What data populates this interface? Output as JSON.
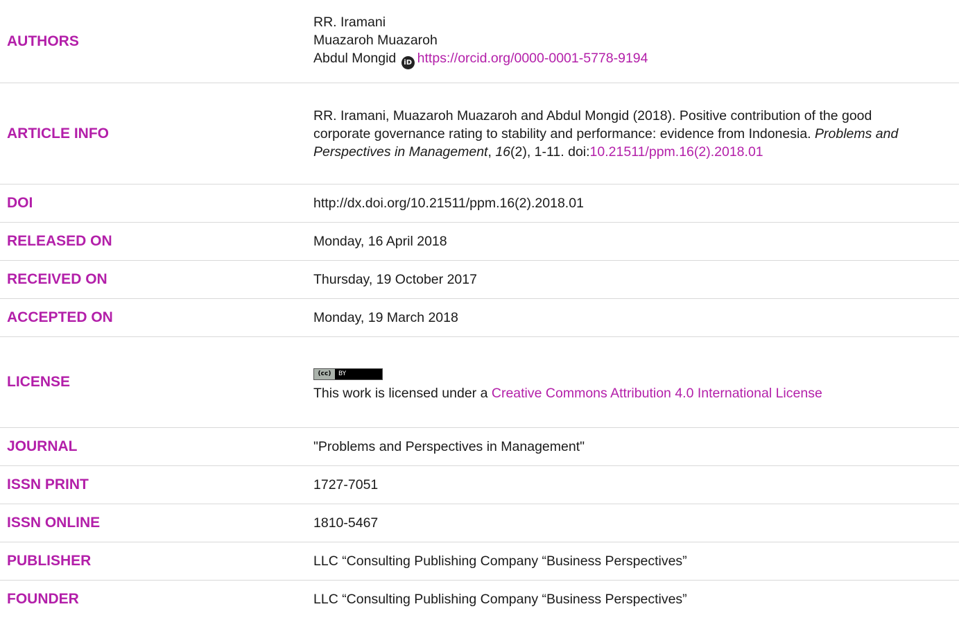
{
  "authors": {
    "label": "AUTHORS",
    "names": [
      "RR. Iramani",
      "Muazaroh Muazaroh",
      "Abdul Mongid"
    ],
    "orcid_icon": "orcid-icon",
    "orcid_url": "https://orcid.org/0000-0001-5778-9194"
  },
  "article_info": {
    "label": "ARTICLE INFO",
    "citation_lead": "RR. Iramani, Muazaroh Muazaroh and Abdul Mongid (2018). Positive contribution of the good corporate governance rating to stability and performance: evidence from Indonesia. ",
    "journal": "Problems and Perspectives in Management",
    "comma": ", ",
    "volume": "16",
    "issue_pages": "(2), 1-11. doi:",
    "doi_link": "10.21511/ppm.16(2).2018.01"
  },
  "doi": {
    "label": "DOI",
    "value": "http://dx.doi.org/10.21511/ppm.16(2).2018.01"
  },
  "released": {
    "label": "RELEASED ON",
    "value": "Monday, 16 April 2018"
  },
  "received": {
    "label": "RECEIVED ON",
    "value": "Thursday, 19 October 2017"
  },
  "accepted": {
    "label": "ACCEPTED ON",
    "value": "Monday, 19 March 2018"
  },
  "license": {
    "label": "LICENSE",
    "badge_cc": "(cc)",
    "badge_by": "BY",
    "text_lead": "This work is licensed under a ",
    "link_text": "Creative Commons Attribution 4.0 International License"
  },
  "journal": {
    "label": "JOURNAL",
    "value": "\"Problems and Perspectives in Management\""
  },
  "issn_print": {
    "label": "ISSN PRINT",
    "value": "1727-7051"
  },
  "issn_online": {
    "label": "ISSN ONLINE",
    "value": "1810-5467"
  },
  "publisher": {
    "label": "PUBLISHER",
    "value": "LLC “Consulting Publishing Company “Business Perspectives”"
  },
  "founder": {
    "label": "FOUNDER",
    "value": "LLC “Consulting Publishing Company “Business Perspectives”"
  },
  "colors": {
    "accent": "#b31fa9",
    "text": "#1a1a1a",
    "divider": "#d9d9d9"
  }
}
